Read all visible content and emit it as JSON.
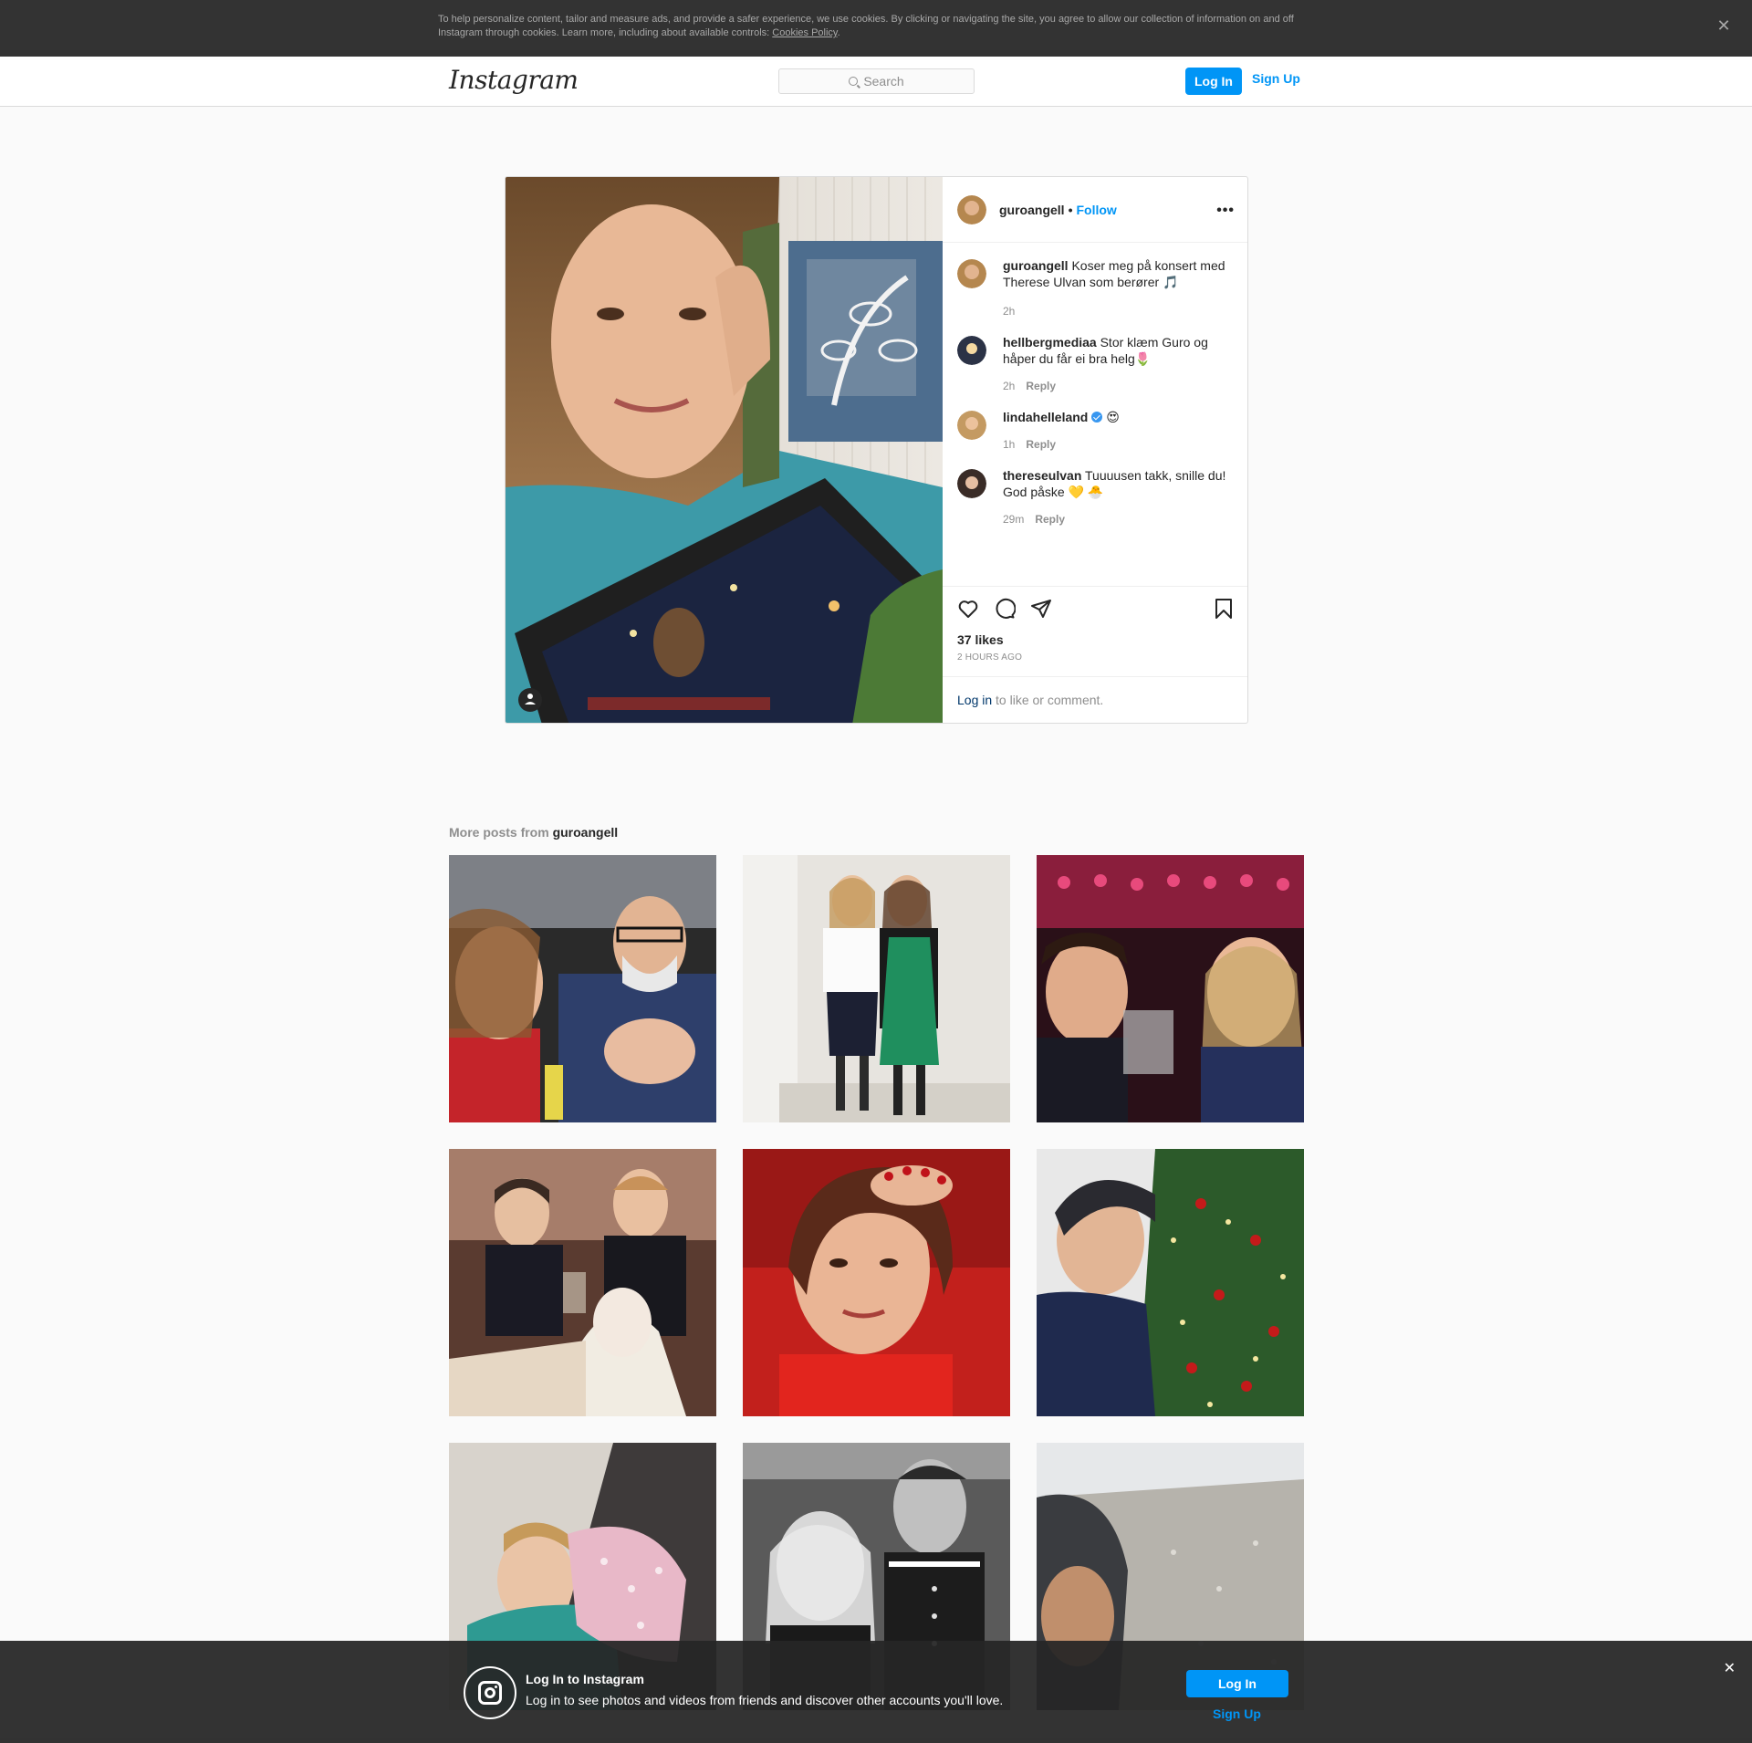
{
  "cookie_banner": {
    "text": "To help personalize content, tailor and measure ads, and provide a safer experience, we use cookies. By clicking or navigating the site, you agree to allow our collection of information on and off Instagram through cookies. Learn more, including about available controls: ",
    "link": "Cookies Policy",
    "link_suffix": ".",
    "close": "✕"
  },
  "nav": {
    "logo": "Instagram",
    "search_placeholder": "Search",
    "login": "Log In",
    "signup": "Sign Up"
  },
  "post": {
    "username": "guroangell",
    "separator": "•",
    "follow": "Follow",
    "more": "•••",
    "comments": [
      {
        "user": "guroangell",
        "text": "Koser meg på konsert med Therese Ulvan som berører 🎵",
        "time": "2h",
        "reply": ""
      },
      {
        "user": "hellbergmediaa",
        "text": "Stor klæm Guro og håper du får ei bra helg🌷",
        "time": "2h",
        "reply": "Reply"
      },
      {
        "user": "lindahelleland",
        "text": "😍",
        "time": "1h",
        "reply": "Reply"
      },
      {
        "user": "thereseulvan",
        "text": "Tuuuusen takk, snille du! God påske 💛 🐣",
        "time": "29m",
        "reply": "Reply"
      }
    ],
    "likes": "37 likes",
    "time_ago": "2 HOURS AGO",
    "login_link": "Log in",
    "login_suffix": " to like or comment."
  },
  "more_posts": {
    "prefix": "More posts from ",
    "user": "guroangell"
  },
  "bottom_banner": {
    "title": "Log In to Instagram",
    "subtitle": "Log in to see photos and videos from friends and discover other accounts you'll love.",
    "login": "Log In",
    "signup": "Sign Up",
    "close": "✕"
  },
  "colors": {
    "accent": "#0095f6",
    "banner": "#333333"
  }
}
